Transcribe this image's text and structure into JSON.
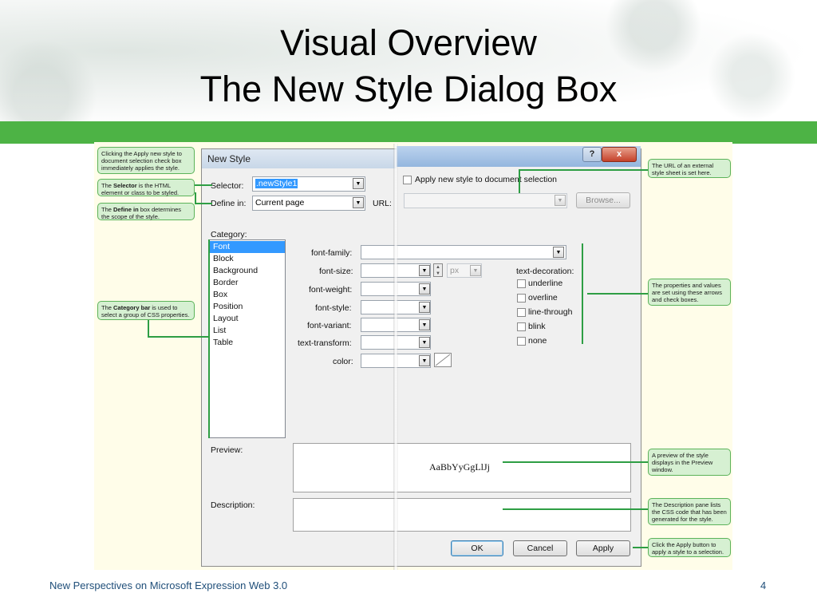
{
  "slide": {
    "title_line1": "Visual Overview",
    "title_line2": "The New Style Dialog Box",
    "footer": "New Perspectives on Microsoft Expression Web 3.0",
    "page_number": "4",
    "accent_green": "#4db345"
  },
  "callouts": {
    "apply": "Clicking the Apply new style to document selection check box immediately applies the style.",
    "selector_pre": "The ",
    "selector_bold": "Selector",
    "selector_post": " is the HTML element or class to be styled.",
    "define_pre": "The ",
    "define_bold": "Define in",
    "define_post": " box determines the scope of the style.",
    "category_pre": "The ",
    "category_bold": "Category bar",
    "category_post": " is used to select a group of CSS properties.",
    "url": "The URL of an external style sheet is set here.",
    "properties": "The properties and values are set using these arrows and check boxes.",
    "preview": "A preview of the style displays in the Preview window.",
    "description": "The Description pane lists the CSS code that has been generated for the style.",
    "apply_button": "Click the Apply button to apply a style to a selection."
  },
  "dialog": {
    "title": "New Style",
    "help": "?",
    "close": "x",
    "apply_checkbox_label": "Apply new style to document selection",
    "selector_label": "Selector:",
    "selector_value": ".newStyle1",
    "define_label": "Define in:",
    "define_value": "Current page",
    "url_label": "URL:",
    "browse": "Browse...",
    "category_label": "Category:",
    "categories": [
      "Font",
      "Block",
      "Background",
      "Border",
      "Box",
      "Position",
      "Layout",
      "List",
      "Table"
    ],
    "props": {
      "font_family": "font-family:",
      "font_size": "font-size:",
      "font_weight": "font-weight:",
      "font_style": "font-style:",
      "font_variant": "font-variant:",
      "text_transform": "text-transform:",
      "color": "color:",
      "unit": "px"
    },
    "text_decoration_label": "text-decoration:",
    "decorations": [
      "underline",
      "overline",
      "line-through",
      "blink",
      "none"
    ],
    "preview_label": "Preview:",
    "preview_text": "AaBbYyGgLlJj",
    "description_label": "Description:",
    "ok": "OK",
    "cancel": "Cancel",
    "apply": "Apply"
  }
}
